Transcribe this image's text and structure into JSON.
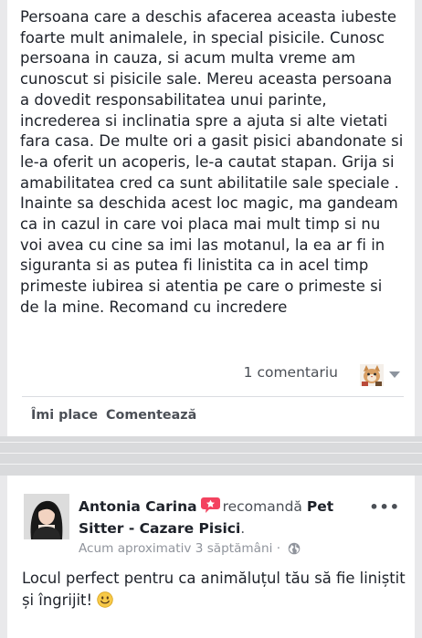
{
  "post1": {
    "review_text": "Persoana care a deschis afacerea aceasta iubeste foarte mult animalele, in special pisicile. Cunosc persoana in cauza, si acum multa vreme am cunoscut si pisicile sale. Mereu aceasta persoana a dovedit responsabilitatea unui parinte, increderea si inclinatia spre a ajuta si alte vietati fara casa. De multe ori a gasit pisici abandonate si le-a oferit un acoperis, le-a cautat stapan. Grija si amabilitatea cred ca sunt abilitatile sale speciale . Inainte sa deschida acest loc magic, ma gandeam ca in cazul in care voi placa mai mult timp si nu voi avea cu cine sa imi las motanul, la ea ar fi in siguranta si as putea fi linistita ca in acel timp primeste iubirea si atentia pe care o primeste si de la mine. Recomand cu incredere",
    "comments_count": "1 comentariu",
    "actions": {
      "like": "Îmi place",
      "comment": "Comentează"
    }
  },
  "post2": {
    "author": "Antonia Carina",
    "verb": "recomandă",
    "page_name": "Pet Sitter - Cazare Pisici",
    "page_suffix": ".",
    "timestamp": "Acum aproximativ 3 săptămâni",
    "separator_dot": "·",
    "more_label": "•••",
    "review_text": "Locul perfect pentru ca animăluțul tău să fie liniștit și îngrijit! "
  },
  "colors": {
    "text": "#1d2129",
    "secondary": "#4b4f56",
    "muted": "#90949c",
    "badge": "#f3425f",
    "background": "#e9e9eb"
  },
  "icons": [
    "commenter-avatar-icon",
    "dropdown-arrow-icon",
    "recommend-badge-icon",
    "globe-icon",
    "smiley-emoji-icon"
  ]
}
